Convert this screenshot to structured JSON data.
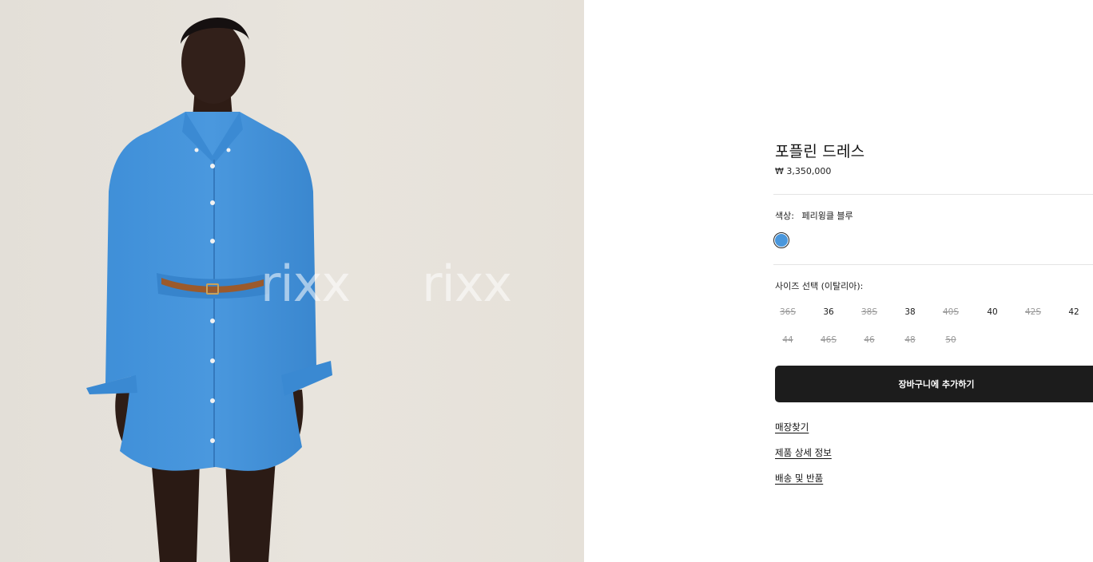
{
  "product": {
    "image_alt": "",
    "watermark": [
      "rixx",
      "rixx"
    ],
    "title": "포플린 드레스",
    "price": "₩ 3,350,000",
    "color": {
      "label": "색상:",
      "value": "페리윙클 블루",
      "swatch_hex": "#4a97dc"
    },
    "size": {
      "label": "사이즈 선택 (이탈리아):",
      "options": [
        {
          "label": "36S",
          "available": false
        },
        {
          "label": "36",
          "available": true
        },
        {
          "label": "38S",
          "available": false
        },
        {
          "label": "38",
          "available": true
        },
        {
          "label": "40S",
          "available": false
        },
        {
          "label": "40",
          "available": true
        },
        {
          "label": "42S",
          "available": false
        },
        {
          "label": "42",
          "available": true
        },
        {
          "label": "44",
          "available": false
        },
        {
          "label": "46S",
          "available": false
        },
        {
          "label": "46",
          "available": false
        },
        {
          "label": "48",
          "available": false
        },
        {
          "label": "50",
          "available": false
        }
      ]
    },
    "add_to_cart": "장바구니에 추가하기",
    "links": [
      "매장찾기",
      "제품 상세 정보",
      "배송 및 반품"
    ]
  }
}
